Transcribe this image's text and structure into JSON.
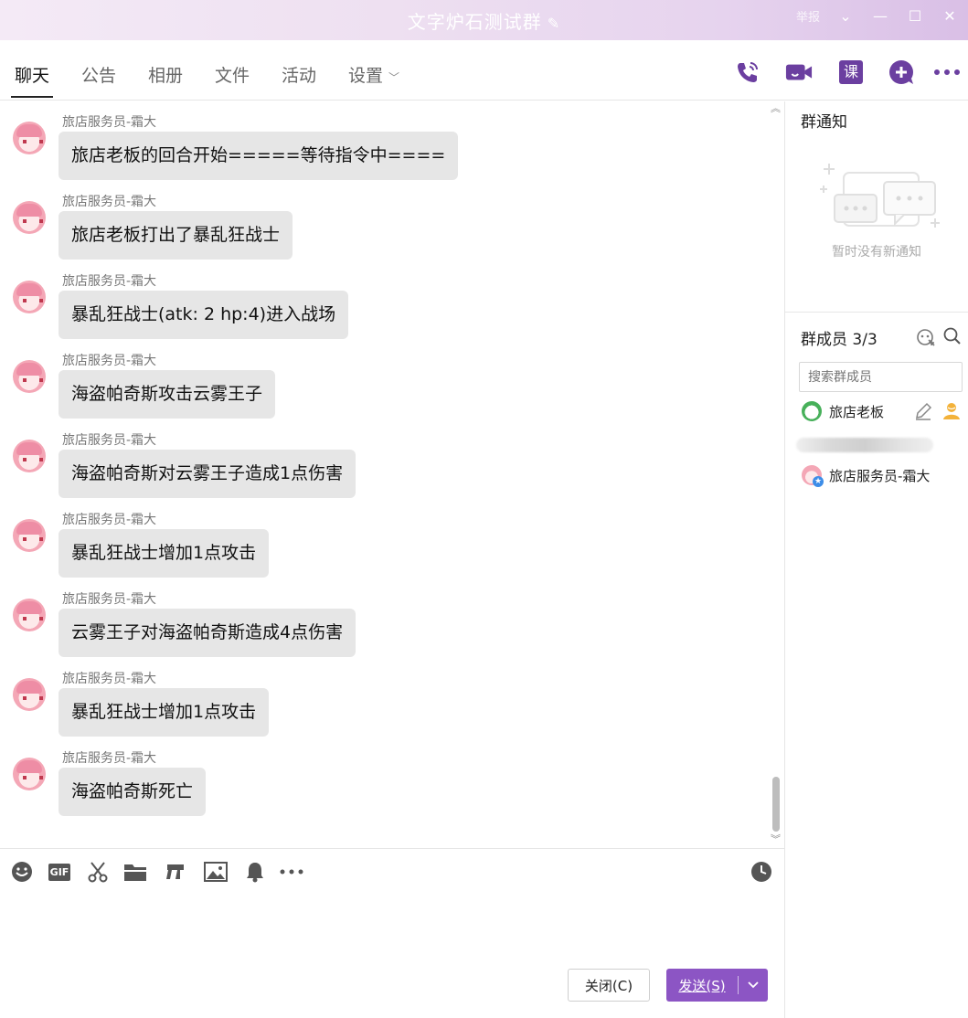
{
  "window": {
    "title": "文字炉石测试群",
    "faint_label": "举报"
  },
  "tabs": [
    {
      "label": "聊天",
      "active": true
    },
    {
      "label": "公告"
    },
    {
      "label": "相册"
    },
    {
      "label": "文件"
    },
    {
      "label": "活动"
    },
    {
      "label": "设置"
    }
  ],
  "toolbar": {
    "class_label": "课",
    "icons": [
      "phone-call-icon",
      "video-call-icon",
      "class-icon",
      "add-icon",
      "more-icon"
    ]
  },
  "messages": [
    {
      "sender": "旅店服务员-霜大",
      "text": "旅店老板的回合开始=====等待指令中===="
    },
    {
      "sender": "旅店服务员-霜大",
      "text": "旅店老板打出了暴乱狂战士"
    },
    {
      "sender": "旅店服务员-霜大",
      "text": "暴乱狂战士(atk: 2 hp:4)进入战场"
    },
    {
      "sender": "旅店服务员-霜大",
      "text": "海盗帕奇斯攻击云雾王子"
    },
    {
      "sender": "旅店服务员-霜大",
      "text": "海盗帕奇斯对云雾王子造成1点伤害"
    },
    {
      "sender": "旅店服务员-霜大",
      "text": "暴乱狂战士增加1点攻击"
    },
    {
      "sender": "旅店服务员-霜大",
      "text": "云雾王子对海盗帕奇斯造成4点伤害"
    },
    {
      "sender": "旅店服务员-霜大",
      "text": "暴乱狂战士增加1点攻击"
    },
    {
      "sender": "旅店服务员-霜大",
      "text": "海盗帕奇斯死亡"
    }
  ],
  "input_toolbar": {
    "gif_label": "GIF",
    "icons": [
      "emoji-icon",
      "gif-icon",
      "scissors-icon",
      "folder-icon",
      "music-icon",
      "image-icon",
      "bell-icon",
      "more-icon",
      "history-clock-icon"
    ]
  },
  "buttons": {
    "close_label": "关闭(C)",
    "send_label": "发送(S)"
  },
  "notice": {
    "title": "群通知",
    "empty_text": "暂时没有新通知"
  },
  "members": {
    "title": "群成员 3/3",
    "search_placeholder": "搜索群成员",
    "list": [
      {
        "name": "旅店老板"
      },
      {
        "name": "旅店服务员-霜大"
      }
    ]
  },
  "colors": {
    "accent": "#8c55c4",
    "toolbar_icon": "#6b3fa0",
    "bubble": "#e6e6e6"
  }
}
